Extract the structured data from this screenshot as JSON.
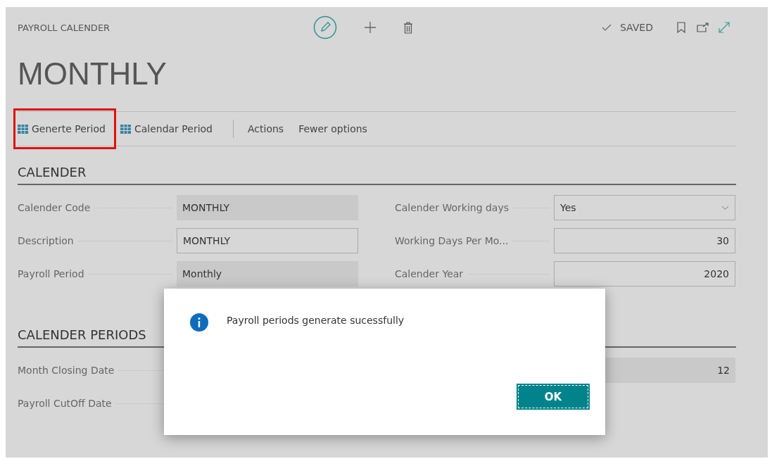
{
  "header": {
    "caption": "PAYROLL CALENDER",
    "status": "SAVED",
    "title": "MONTHLY"
  },
  "actions": [
    {
      "kind": "icon",
      "label": "Generte Period",
      "highlighted": true
    },
    {
      "kind": "icon",
      "label": "Calendar Period",
      "highlighted": false
    },
    {
      "kind": "divider"
    },
    {
      "kind": "text",
      "label": "Actions",
      "highlighted": false
    },
    {
      "kind": "text",
      "label": "Fewer options",
      "highlighted": false
    }
  ],
  "sections": [
    {
      "title": "CALENDER",
      "rows": [
        [
          {
            "label": "Calender Code",
            "value": "MONTHLY",
            "kind": "readonly"
          },
          {
            "label": "Calender Working days",
            "value": "Yes",
            "kind": "dropdown"
          }
        ],
        [
          {
            "label": "Description",
            "value": "MONTHLY",
            "kind": "input"
          },
          {
            "label": "Working Days Per Mo...",
            "value": "30",
            "kind": "number"
          }
        ],
        [
          {
            "label": "Payroll Period",
            "value": "Monthly",
            "kind": "readonly"
          },
          {
            "label": "Calender Year",
            "value": "2020",
            "kind": "number"
          }
        ]
      ]
    },
    {
      "title": "CALENDER PERIODS",
      "rows": [
        [
          {
            "label": "Month Closing Date",
            "kind": "hidden"
          },
          {
            "value": "12",
            "kind": "readonly-number"
          }
        ],
        [
          {
            "label": "Payroll CutOff Date",
            "kind": "hidden"
          },
          {
            "kind": "none"
          }
        ]
      ]
    }
  ],
  "dialog": {
    "message": "Payroll periods generate sucessfully",
    "button": "OK"
  }
}
